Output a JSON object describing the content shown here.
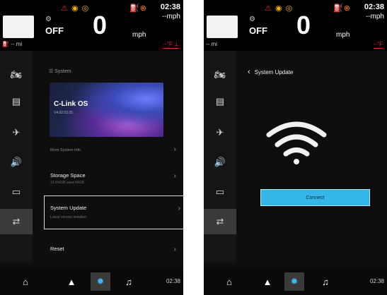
{
  "status": {
    "time": "02:38",
    "speed_readout": "--mph",
    "mode": "OFF",
    "speed": "0",
    "unit": "mph",
    "range": "-- mi",
    "temperature": "--°F"
  },
  "rail_icons": [
    "motorcycle-icon",
    "dashboard-icon",
    "satellite-icon",
    "speaker-icon",
    "display-icon",
    "settings-sliders-icon"
  ],
  "screen_a": {
    "breadcrumb": "System",
    "banner_title": "C-Link OS",
    "banner_version": "V4.02.02.05",
    "more_info": "More System Info",
    "storage_title": "Storage Space",
    "storage_sub": "12.6%GB used 64GB",
    "update_title": "System Update",
    "update_sub": "Latest version installed",
    "reset_title": "Reset"
  },
  "screen_b": {
    "title": "System Update",
    "connect_label": "Connect"
  },
  "bottom": {
    "clock": "02:38"
  },
  "colors": {
    "accent": "#34b6e8",
    "warning": "#e0263a",
    "engine": "#ff7a1a"
  }
}
